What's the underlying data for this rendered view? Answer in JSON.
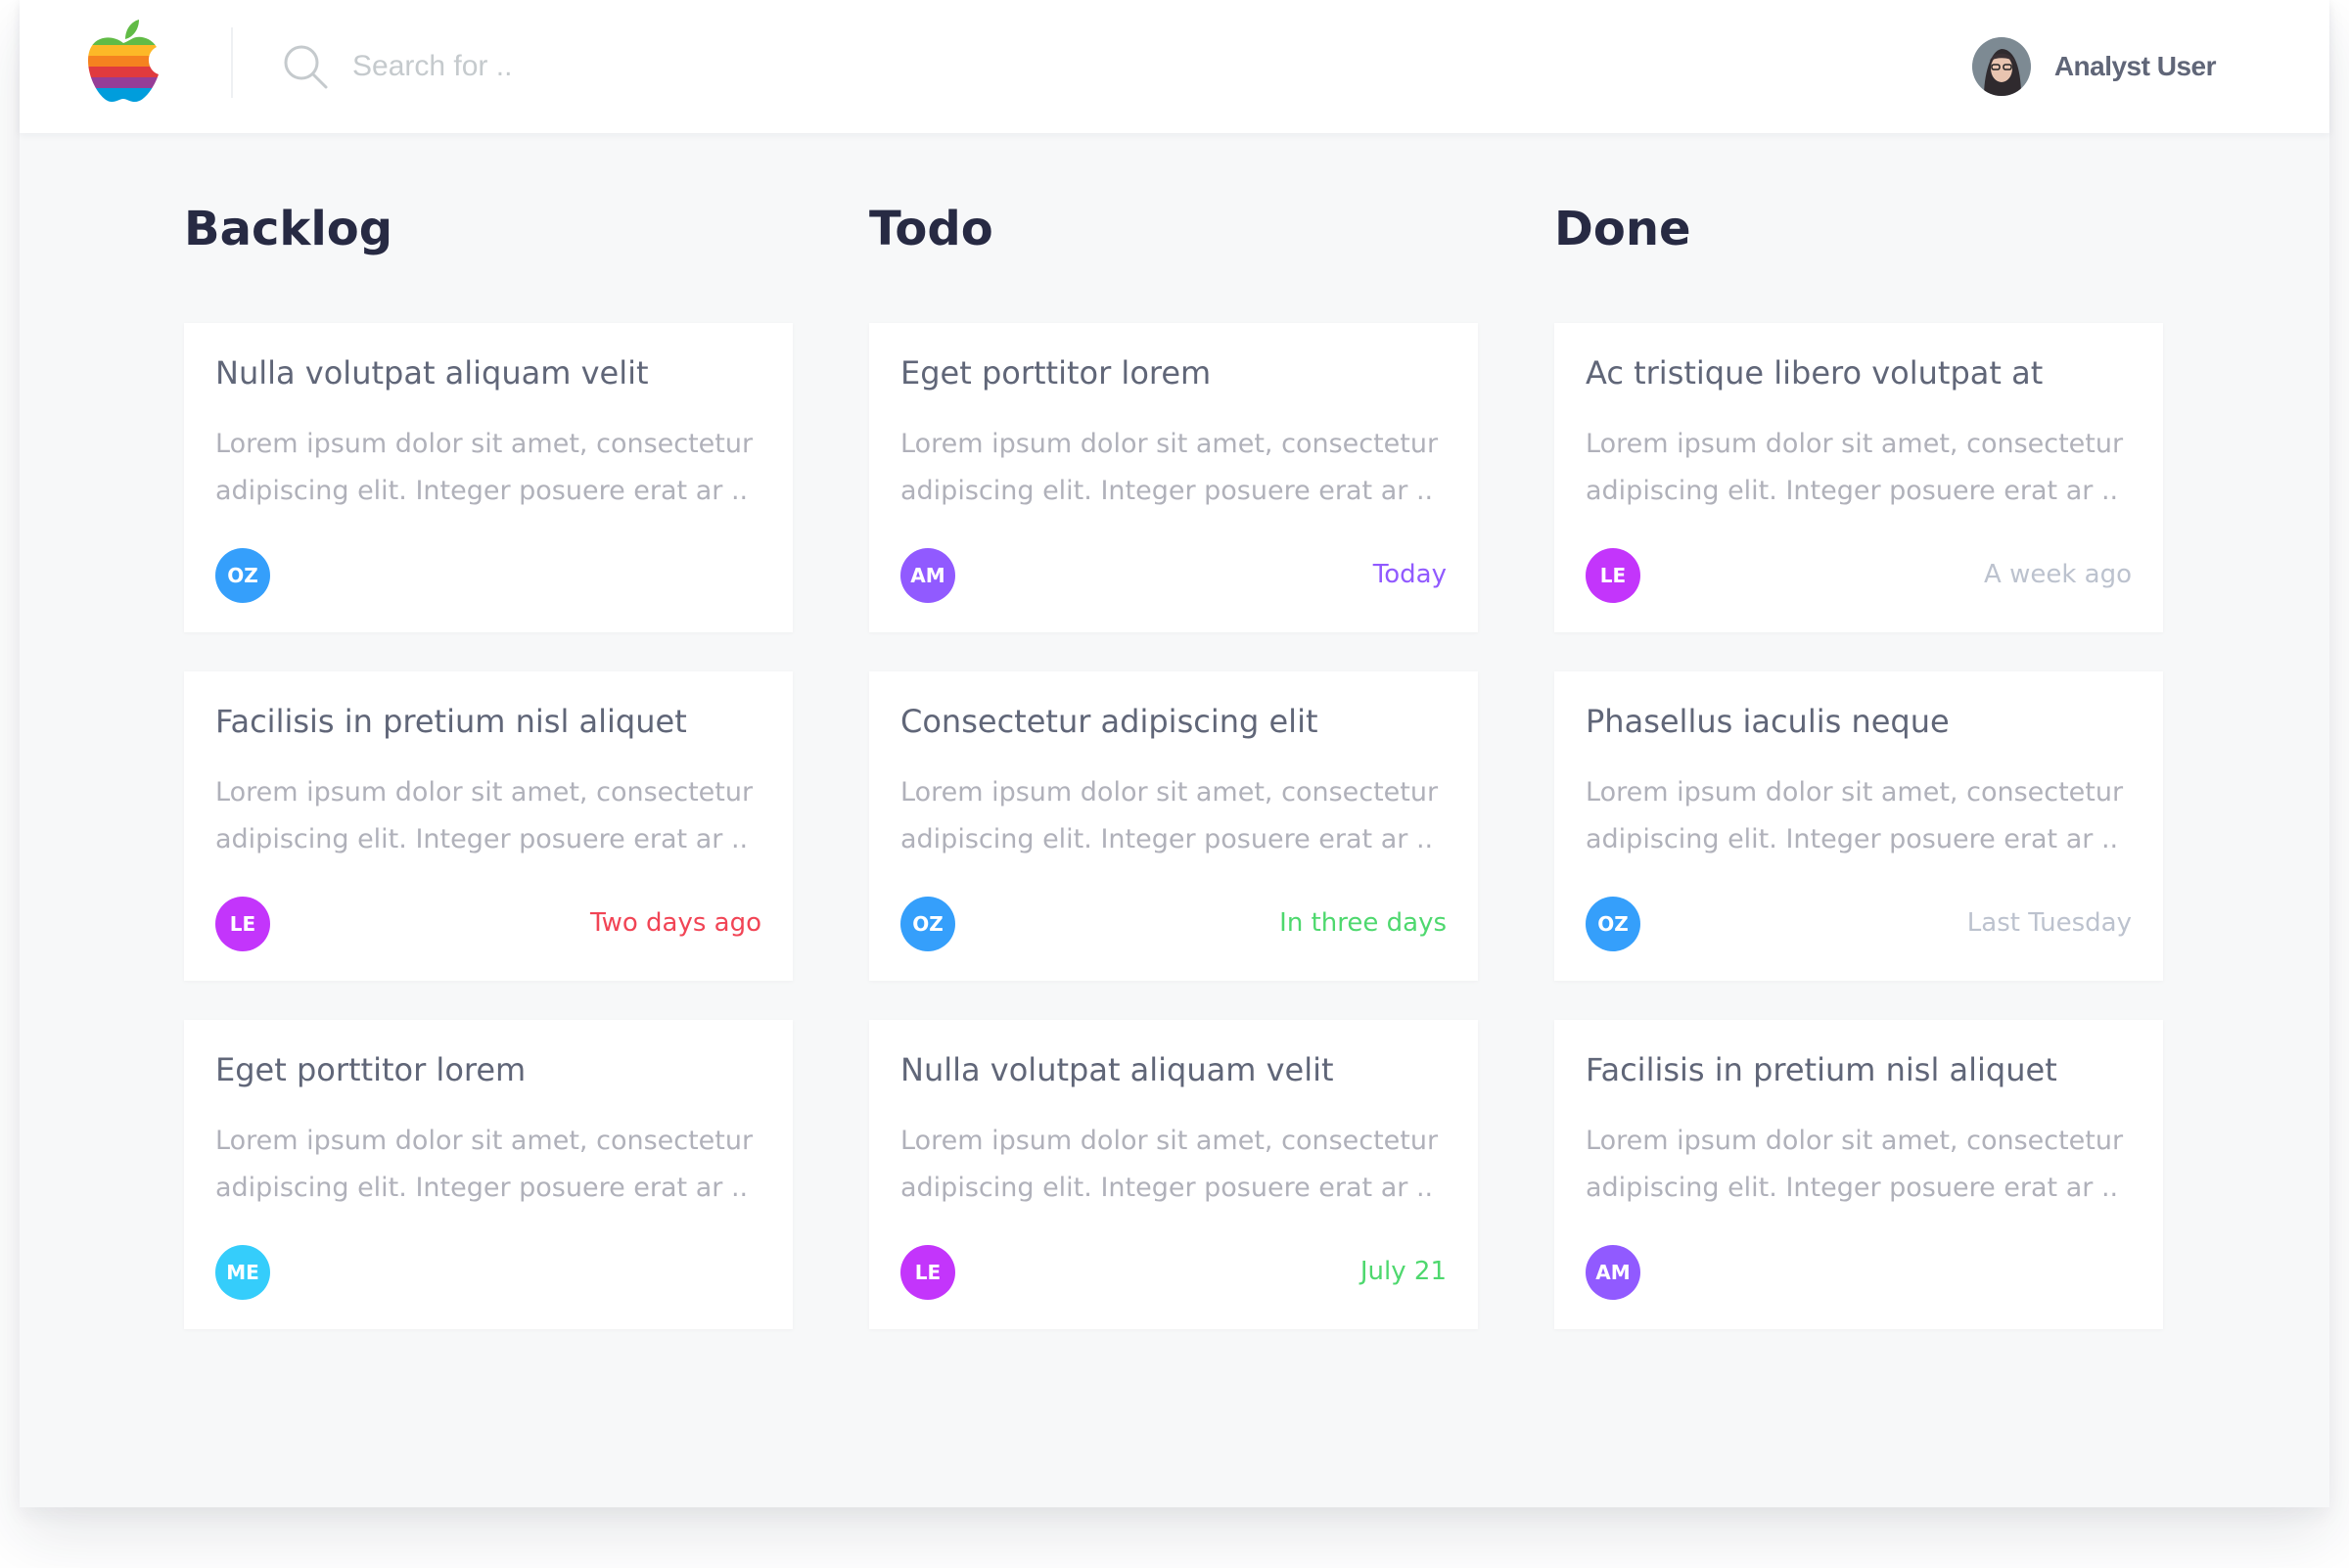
{
  "colors": {
    "page_bg": "#f7f8f9",
    "surface": "#ffffff",
    "heading": "#272a43",
    "text_secondary": "#606678",
    "text_muted": "#b0b1ba",
    "placeholder": "#c5cacd",
    "date_today": "#915aff",
    "date_overdue": "#f14455",
    "date_upcoming": "#4ed86e",
    "date_past": "#bcc2ce"
  },
  "header": {
    "logo_icon": "apple-rainbow-icon",
    "search": {
      "placeholder": "Search for ..",
      "value": "",
      "icon": "search-icon"
    },
    "user": {
      "name": "Analyst User",
      "avatar": "user-avatar-photo"
    }
  },
  "columns": [
    {
      "title": "Backlog",
      "cards": [
        {
          "title": "Nulla volutpat aliquam velit",
          "body": "Lorem ipsum dolor sit amet, consectetur adipiscing elit. Integer posuere erat ar ..",
          "avatar": {
            "initials": "OZ",
            "color": "#359ffb"
          },
          "date": "",
          "date_color": ""
        },
        {
          "title": "Facilisis in pretium nisl aliquet",
          "body": "Lorem ipsum dolor sit amet, consectetur adipiscing elit. Integer posuere erat ar ..",
          "avatar": {
            "initials": "LE",
            "color": "#c335fb"
          },
          "date": "Two days ago",
          "date_color": "#f14455"
        },
        {
          "title": "Eget porttitor lorem",
          "body": "Lorem ipsum dolor sit amet, consectetur adipiscing elit. Integer posuere erat ar ..",
          "avatar": {
            "initials": "ME",
            "color": "#35cdfb"
          },
          "date": "",
          "date_color": ""
        }
      ]
    },
    {
      "title": "Todo",
      "cards": [
        {
          "title": "Eget porttitor lorem",
          "body": "Lorem ipsum dolor sit amet, consectetur adipiscing elit. Integer posuere erat ar ..",
          "avatar": {
            "initials": "AM",
            "color": "#915aff"
          },
          "date": "Today",
          "date_color": "#915aff"
        },
        {
          "title": "Consectetur adipiscing elit",
          "body": "Lorem ipsum dolor sit amet, consectetur adipiscing elit. Integer posuere erat ar ..",
          "avatar": {
            "initials": "OZ",
            "color": "#359ffb"
          },
          "date": "In three days",
          "date_color": "#4ed86e"
        },
        {
          "title": "Nulla volutpat aliquam velit",
          "body": "Lorem ipsum dolor sit amet, consectetur adipiscing elit. Integer posuere erat ar ..",
          "avatar": {
            "initials": "LE",
            "color": "#c335fb"
          },
          "date": "July 21",
          "date_color": "#4ed86e"
        }
      ]
    },
    {
      "title": "Done",
      "cards": [
        {
          "title": "Ac tristique libero volutpat at",
          "body": "Lorem ipsum dolor sit amet, consectetur adipiscing elit. Integer posuere erat ar ..",
          "avatar": {
            "initials": "LE",
            "color": "#c335fb"
          },
          "date": "A week ago",
          "date_color": "#bcc2ce"
        },
        {
          "title": "Phasellus iaculis neque",
          "body": "Lorem ipsum dolor sit amet, consectetur adipiscing elit. Integer posuere erat ar ..",
          "avatar": {
            "initials": "OZ",
            "color": "#359ffb"
          },
          "date": "Last Tuesday",
          "date_color": "#bcc2ce"
        },
        {
          "title": "Facilisis in pretium nisl aliquet",
          "body": "Lorem ipsum dolor sit amet, consectetur adipiscing elit. Integer posuere erat ar ..",
          "avatar": {
            "initials": "AM",
            "color": "#915aff"
          },
          "date": "",
          "date_color": ""
        }
      ]
    }
  ]
}
